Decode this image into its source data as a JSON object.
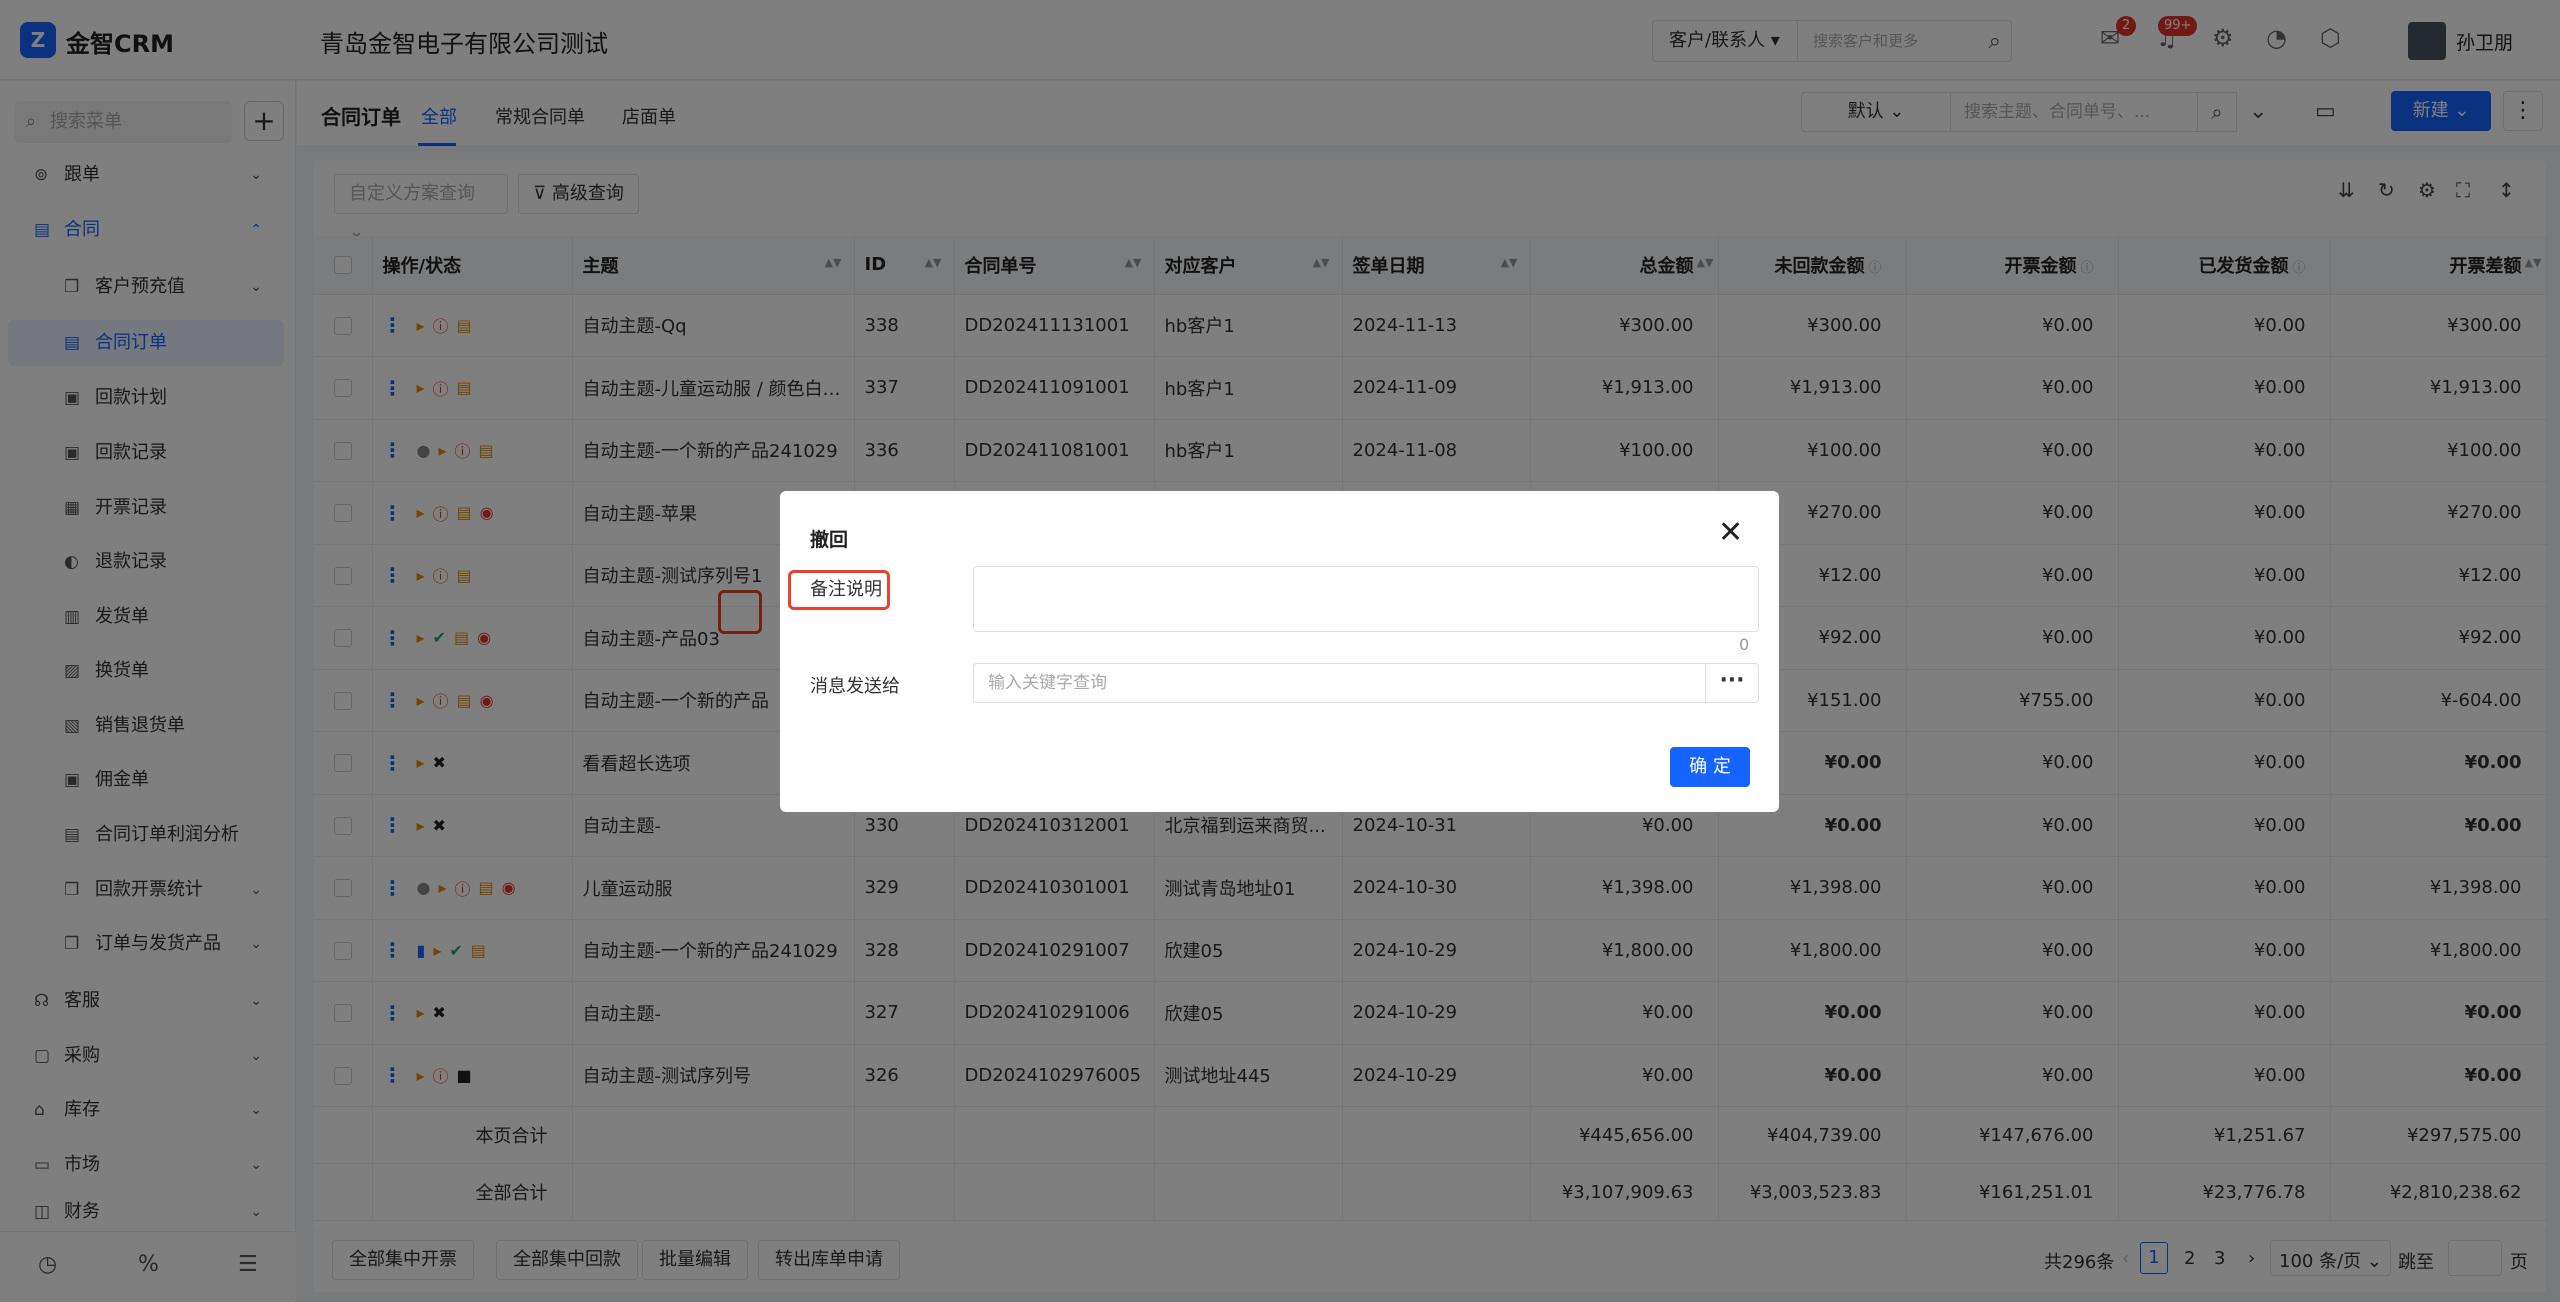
{
  "app": {
    "logo_text": "金智CRM",
    "company": "青岛金智电子有限公司测试",
    "user_name": "孙卫朋"
  },
  "global_search": {
    "scope": "客户/联系人",
    "placeholder": "搜索客户和更多"
  },
  "badges": {
    "messages": "2",
    "notifications": "99+"
  },
  "sidebar": {
    "search_placeholder": "搜索菜单",
    "items": [
      {
        "label": "跟单",
        "icon": "target-icon"
      },
      {
        "label": "合同",
        "icon": "document-icon"
      },
      {
        "label": "客户预充值",
        "icon": "copy-icon"
      },
      {
        "label": "合同订单",
        "icon": "document-icon"
      },
      {
        "label": "回款计划",
        "icon": "money-icon"
      },
      {
        "label": "回款记录",
        "icon": "money-icon"
      },
      {
        "label": "开票记录",
        "icon": "printer-icon"
      },
      {
        "label": "退款记录",
        "icon": "refund-icon"
      },
      {
        "label": "发货单",
        "icon": "box-icon"
      },
      {
        "label": "换货单",
        "icon": "swap-icon"
      },
      {
        "label": "销售退货单",
        "icon": "return-icon"
      },
      {
        "label": "佣金单",
        "icon": "money-icon"
      },
      {
        "label": "合同订单利润分析",
        "icon": "document-icon"
      },
      {
        "label": "回款开票统计",
        "icon": "copy-icon"
      },
      {
        "label": "订单与发货产品",
        "icon": "copy-icon"
      },
      {
        "label": "客服",
        "icon": "headset-icon"
      },
      {
        "label": "采购",
        "icon": "bag-icon"
      },
      {
        "label": "库存",
        "icon": "warehouse-icon"
      },
      {
        "label": "市场",
        "icon": "calendar-icon"
      },
      {
        "label": "财务",
        "icon": "wallet-icon"
      }
    ]
  },
  "header": {
    "title": "合同订单",
    "tabs": [
      "全部",
      "常规合同单",
      "店面单"
    ],
    "view": "默认",
    "search_placeholder": "搜索主题、合同单号、...",
    "new_label": "新建"
  },
  "filters": {
    "custom_query": "自定义方案查询",
    "advanced": "高级查询"
  },
  "table": {
    "columns": [
      "操作/状态",
      "主题",
      "ID",
      "合同单号",
      "对应客户",
      "签单日期",
      "总金额",
      "未回款金额",
      "开票金额",
      "已发货金额",
      "开票差额"
    ],
    "rows": [
      {
        "subject": "自动主题-Qq",
        "id": "338",
        "no": "DD202411131001",
        "customer": "hb客户1",
        "date": "2024-11-13",
        "total": "¥300.00",
        "unpaid": "¥300.00",
        "invoiced": "¥0.00",
        "shipped": "¥0.00",
        "diff": "¥300.00"
      },
      {
        "subject": "自动主题-儿童运动服 / 颜色白色...",
        "id": "337",
        "no": "DD202411091001",
        "customer": "hb客户1",
        "date": "2024-11-09",
        "total": "¥1,913.00",
        "unpaid": "¥1,913.00",
        "invoiced": "¥0.00",
        "shipped": "¥0.00",
        "diff": "¥1,913.00"
      },
      {
        "subject": "自动主题-一个新的产品241029",
        "id": "336",
        "no": "DD202411081001",
        "customer": "hb客户1",
        "date": "2024-11-08",
        "total": "¥100.00",
        "unpaid": "¥100.00",
        "invoiced": "¥0.00",
        "shipped": "¥0.00",
        "diff": "¥100.00"
      },
      {
        "subject": "自动主题-苹果",
        "id": "",
        "no": "",
        "customer": "",
        "date": "",
        "total": "",
        "unpaid": "¥270.00",
        "invoiced": "¥0.00",
        "shipped": "¥0.00",
        "diff": "¥270.00"
      },
      {
        "subject": "自动主题-测试序列号1",
        "id": "",
        "no": "",
        "customer": "",
        "date": "",
        "total": "",
        "unpaid": "¥12.00",
        "invoiced": "¥0.00",
        "shipped": "¥0.00",
        "diff": "¥12.00"
      },
      {
        "subject": "自动主题-产品03",
        "id": "",
        "no": "",
        "customer": "",
        "date": "",
        "total": "",
        "unpaid": "¥92.00",
        "invoiced": "¥0.00",
        "shipped": "¥0.00",
        "diff": "¥92.00"
      },
      {
        "subject": "自动主题-一个新的产品",
        "id": "",
        "no": "",
        "customer": "",
        "date": "",
        "total": "",
        "unpaid": "¥151.00",
        "invoiced": "¥755.00",
        "shipped": "¥0.00",
        "diff": "¥-604.00"
      },
      {
        "subject": "看看超长选项",
        "id": "",
        "no": "",
        "customer": "",
        "date": "",
        "total": "",
        "unpaid": "¥0.00",
        "invoiced": "¥0.00",
        "shipped": "¥0.00",
        "diff": "¥0.00"
      },
      {
        "subject": "自动主题-",
        "id": "330",
        "no": "DD202410312001",
        "customer": "北京福到运来商贸...",
        "date": "2024-10-31",
        "total": "¥0.00",
        "unpaid": "¥0.00",
        "invoiced": "¥0.00",
        "shipped": "¥0.00",
        "diff": "¥0.00"
      },
      {
        "subject": "儿童运动服",
        "id": "329",
        "no": "DD202410301001",
        "customer": "测试青岛地址01",
        "date": "2024-10-30",
        "total": "¥1,398.00",
        "unpaid": "¥1,398.00",
        "invoiced": "¥0.00",
        "shipped": "¥0.00",
        "diff": "¥1,398.00"
      },
      {
        "subject": "自动主题-一个新的产品241029",
        "id": "328",
        "no": "DD202410291007",
        "customer": "欣建05",
        "date": "2024-10-29",
        "total": "¥1,800.00",
        "unpaid": "¥1,800.00",
        "invoiced": "¥0.00",
        "shipped": "¥0.00",
        "diff": "¥1,800.00"
      },
      {
        "subject": "自动主题-",
        "id": "327",
        "no": "DD202410291006",
        "customer": "欣建05",
        "date": "2024-10-29",
        "total": "¥0.00",
        "unpaid": "¥0.00",
        "invoiced": "¥0.00",
        "shipped": "¥0.00",
        "diff": "¥0.00"
      },
      {
        "subject": "自动主题-测试序列号",
        "id": "326",
        "no": "DD2024102976005",
        "customer": "测试地址445",
        "date": "2024-10-29",
        "total": "¥0.00",
        "unpaid": "¥0.00",
        "invoiced": "¥0.00",
        "shipped": "¥0.00",
        "diff": "¥0.00"
      }
    ],
    "page_total": {
      "label": "本页合计",
      "total": "¥445,656.00",
      "unpaid": "¥404,739.00",
      "invoiced": "¥147,676.00",
      "shipped": "¥1,251.67",
      "diff": "¥297,575.00"
    },
    "all_total": {
      "label": "全部合计",
      "total": "¥3,107,909.63",
      "unpaid": "¥3,003,523.83",
      "invoiced": "¥161,251.01",
      "shipped": "¥23,776.78",
      "diff": "¥2,810,238.62"
    }
  },
  "footer": {
    "buttons": [
      "全部集中开票",
      "全部集中回款",
      "批量编辑",
      "转出库单申请"
    ],
    "total_text": "共296条",
    "pages": [
      "1",
      "2",
      "3"
    ],
    "page_size": "100 条/页",
    "jump_label": "跳至",
    "page_unit": "页"
  },
  "modal": {
    "title": "撤回",
    "remark_label": "备注说明",
    "char_count": "0",
    "send_to_label": "消息发送给",
    "send_to_placeholder": "输入关键字查询",
    "more": "···",
    "ok_label": "确 定"
  }
}
